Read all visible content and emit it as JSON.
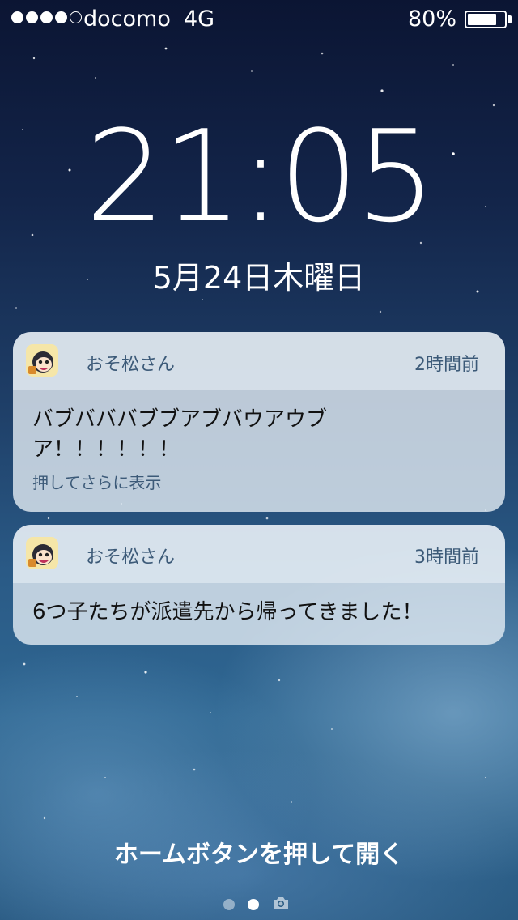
{
  "status_bar": {
    "carrier": "docomo",
    "network": "4G",
    "battery_percent": "80%",
    "battery_level": 0.8,
    "signal_bars_filled": 4,
    "signal_bars_total": 5
  },
  "lock_screen": {
    "time": "21:05",
    "date": "5月24日木曜日",
    "unlock_hint": "ホームボタンを押して開く"
  },
  "notifications": [
    {
      "app_name": "おそ松さん",
      "time_ago": "2時間前",
      "message_line1": "バブバババブブアブバウアウブ",
      "message_line2": "ア！！！！！！",
      "more_hint": "押してさらに表示"
    },
    {
      "app_name": "おそ松さん",
      "time_ago": "3時間前",
      "message": "6つ子たちが派遣先から帰ってきました！"
    }
  ],
  "page_indicator": {
    "pages": 2,
    "current": 2,
    "icons": [
      "page-dot",
      "page-dot",
      "camera-icon"
    ]
  },
  "colors": {
    "notification_bg": "#e4ecf4",
    "secondary_text": "#3c5a78",
    "sky_top": "#0b1533",
    "sky_bottom": "#2f6792"
  }
}
